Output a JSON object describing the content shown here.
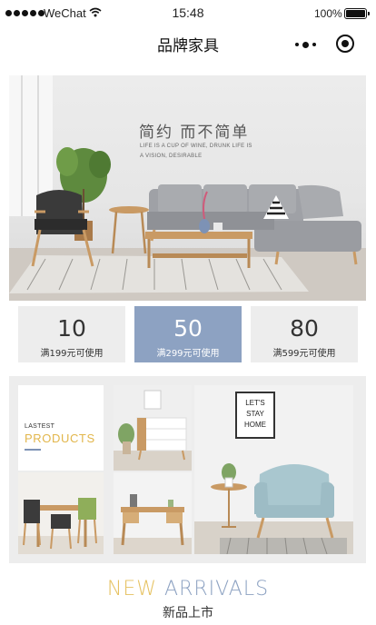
{
  "status_bar": {
    "carrier": "WeChat",
    "time": "15:48",
    "battery": "100%",
    "battery_level": 1.0
  },
  "nav": {
    "title": "品牌家具",
    "more_icon": "more-dots-icon",
    "close_icon": "mini-program-close-icon"
  },
  "banner": {
    "headline": "简约  而不简单",
    "line1": "LIFE IS A CUP OF WINE, DRUNK LIFE IS",
    "line2": "A VISION, DESIRABLE",
    "wall_tags": []
  },
  "coupons": [
    {
      "amount": "10",
      "condition": "满199元可使用",
      "active": false
    },
    {
      "amount": "50",
      "condition": "满299元可使用",
      "active": true
    },
    {
      "amount": "80",
      "condition": "满599元可使用",
      "active": false
    }
  ],
  "grid": {
    "lastest_small": "LASTEST",
    "lastest_big": "PRODUCTS",
    "poster_text": [
      "LET'S",
      "STAY",
      "HOME"
    ]
  },
  "section": {
    "title_part1": "NEW ",
    "title_part2": "ARRIVALS",
    "subtitle": "新品上市"
  },
  "colors": {
    "accent_blue": "#8da2c2",
    "accent_gold": "#e2b64b",
    "coupon_bg": "#ededed"
  }
}
